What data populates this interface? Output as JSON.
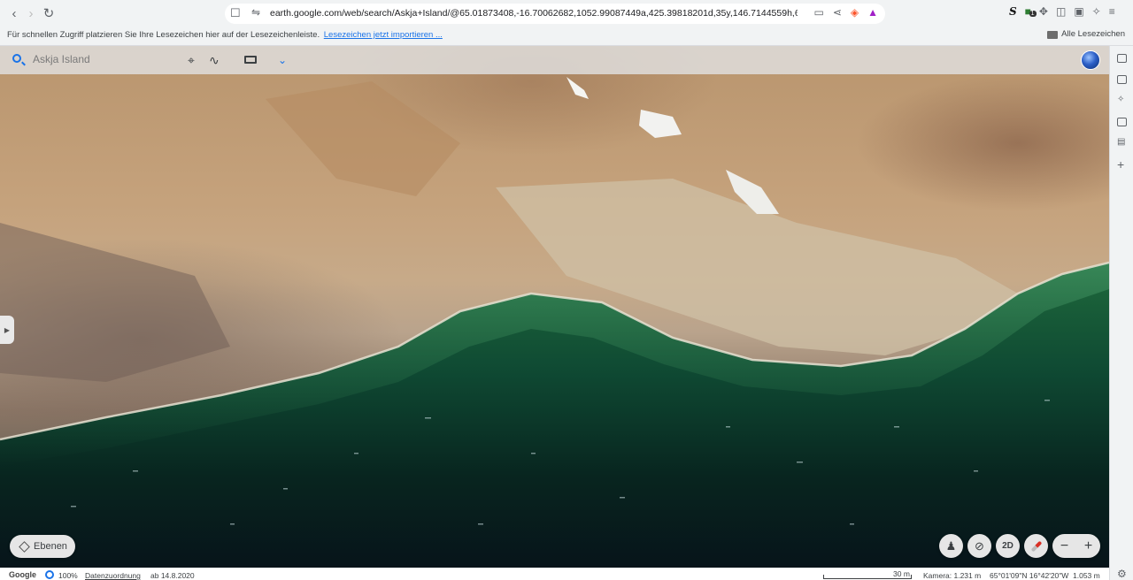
{
  "browser": {
    "url": "earth.google.com/web/search/Askja+Island/@65.01873408,-16.70062682,1052.99087449a,425.39818201d,35y,146.7144559h,65.2487699...",
    "extension_badge": "1"
  },
  "bookmarks_bar": {
    "hint_text": "Für schnellen Zugriff platzieren Sie Ihre Lesezeichen hier auf der Lesezeichenleiste.",
    "import_link": "Lesezeichen jetzt importieren ...",
    "all_bookmarks": "Alle Lesezeichen"
  },
  "earth": {
    "search": {
      "value": "Askja Island"
    },
    "layers_label": "Ebenen",
    "btn_2d": "2D",
    "zoom_out": "−",
    "zoom_in": "+"
  },
  "status": {
    "brand": "Google",
    "zoom": "100%",
    "attribution": "Datenzuordnung",
    "imagery_date": "ab 14.8.2020",
    "scale": "30 m",
    "camera": "Kamera: 1.231 m",
    "coords": "65°01'09\"N 16°42'20\"W",
    "altitude": "1.053 m"
  },
  "colors": {
    "accent": "#1a73e8",
    "water_deep": "#0c2a22",
    "water_shallow": "#2f7f4a",
    "terrain": "#c2a07a"
  }
}
